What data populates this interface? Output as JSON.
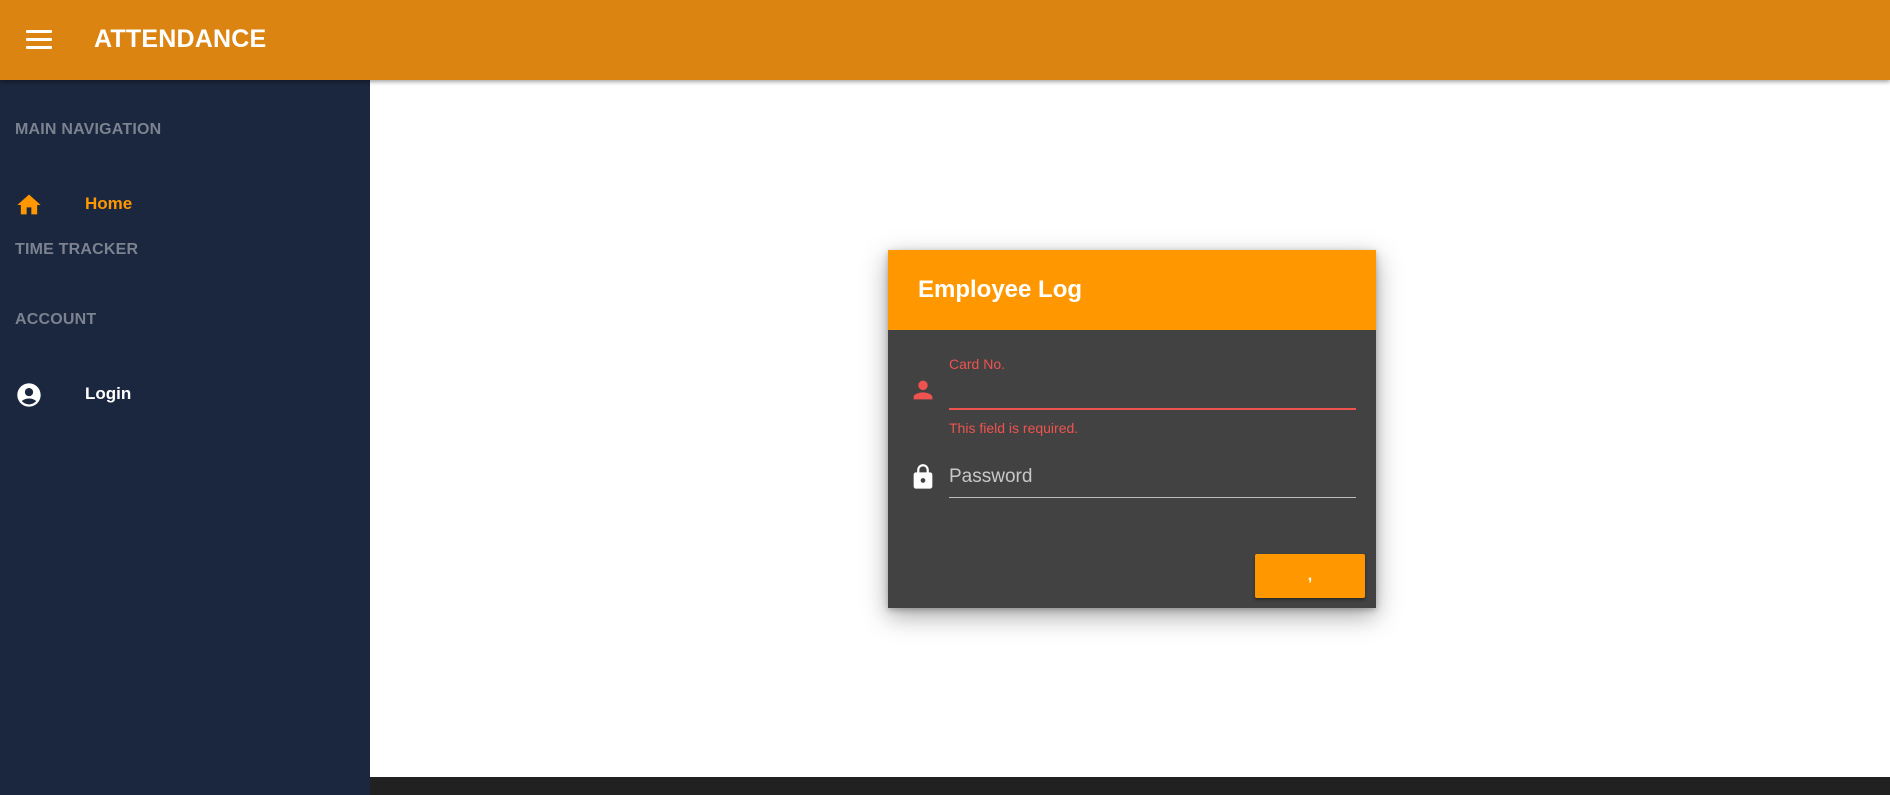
{
  "app": {
    "title": "ATTENDANCE",
    "accent_color": "#db8412"
  },
  "sidebar": {
    "sections": [
      {
        "heading": "MAIN NAVIGATION",
        "items": [
          {
            "label": "Home",
            "icon": "home-icon",
            "active": true
          }
        ]
      },
      {
        "heading": "TIME TRACKER",
        "items": []
      },
      {
        "heading": "ACCOUNT",
        "items": [
          {
            "label": "Login",
            "icon": "account-circle-icon",
            "active": false
          }
        ]
      }
    ]
  },
  "login_card": {
    "title": "Employee Log",
    "card_no": {
      "label": "Card No.",
      "value": "",
      "error": "This field is required.",
      "icon": "person-icon"
    },
    "password": {
      "placeholder": "Password",
      "value": "",
      "icon": "lock-icon"
    },
    "submit_label": ","
  },
  "colors": {
    "sidebar_bg": "#1b273e",
    "card_bg": "#424242",
    "button": "#ff9800",
    "error": "#ef5350",
    "active_nav": "#ff9800"
  }
}
